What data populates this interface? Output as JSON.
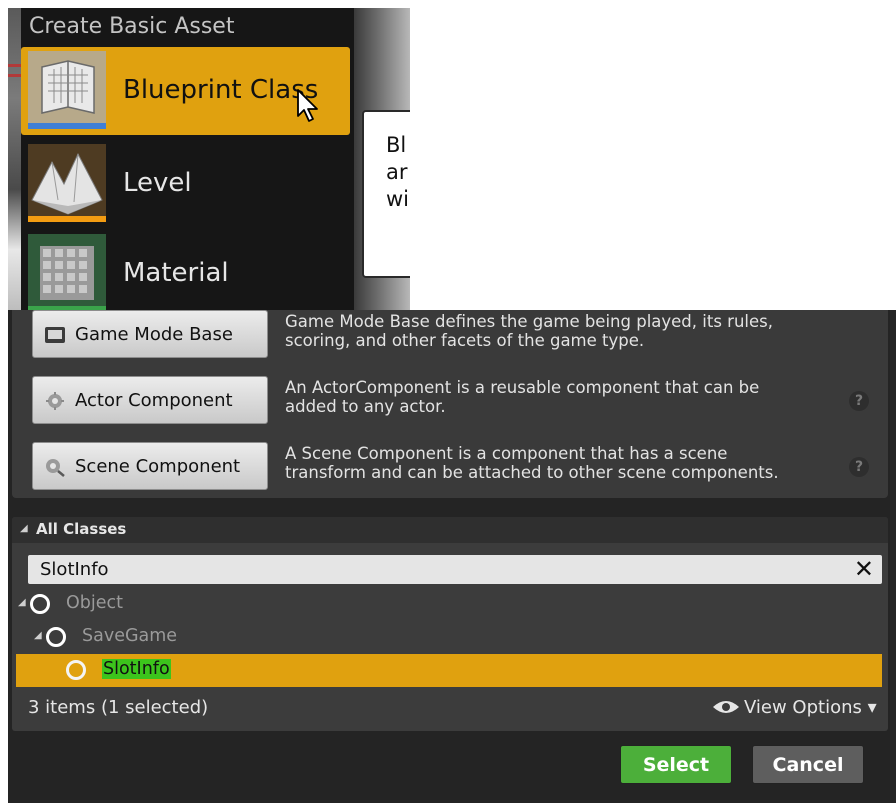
{
  "asset_menu": {
    "title": "Create Basic Asset",
    "items": [
      {
        "label": "Blueprint Class",
        "icon": "blueprint-icon",
        "selected": true,
        "accent": "#3f7fd6"
      },
      {
        "label": "Level",
        "icon": "level-icon",
        "selected": false,
        "accent": "#f39c12"
      },
      {
        "label": "Material",
        "icon": "material-icon",
        "selected": false,
        "accent": "#3aa34a"
      }
    ],
    "tooltip_lines": [
      "Bl",
      "ar",
      "wi"
    ]
  },
  "common_classes": [
    {
      "label": "Game Mode Base",
      "icon": "game-mode-icon",
      "desc_1": "Game Mode Base defines the game being played, its rules,",
      "desc_2": "scoring, and other facets of the game type.",
      "help": false
    },
    {
      "label": "Actor Component",
      "icon": "actor-component-icon",
      "desc_1": "An ActorComponent is a reusable component that can be",
      "desc_2": "added to any actor.",
      "help": true
    },
    {
      "label": "Scene Component",
      "icon": "scene-component-icon",
      "desc_1": "A Scene Component is a component that has a scene",
      "desc_2": "transform and can be attached to other scene components.",
      "help": true
    }
  ],
  "all_classes": {
    "header": "All Classes",
    "search_value": "SlotInfo",
    "clear_symbol": "✕",
    "tree": [
      {
        "name": "Object",
        "depth": 0,
        "expanded": true
      },
      {
        "name": "SaveGame",
        "depth": 1,
        "expanded": true
      },
      {
        "name": "SlotInfo",
        "depth": 2,
        "selected": true
      }
    ],
    "status": "3 items (1 selected)",
    "view_options": "View Options"
  },
  "buttons": {
    "select": "Select",
    "cancel": "Cancel"
  },
  "colors": {
    "selection": "#e0a10f",
    "highlight": "#3cc41c",
    "select_button": "#4caf3a"
  }
}
